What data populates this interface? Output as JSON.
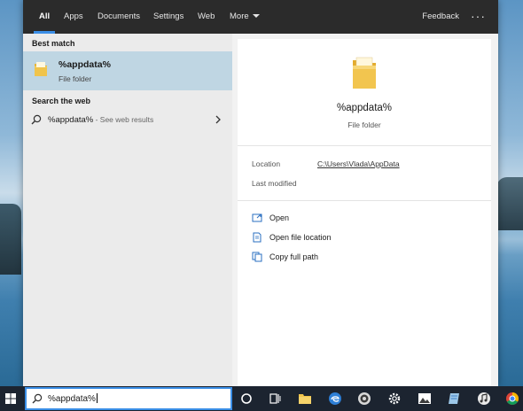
{
  "tabs": [
    {
      "label": "All",
      "active": true
    },
    {
      "label": "Apps"
    },
    {
      "label": "Documents"
    },
    {
      "label": "Settings"
    },
    {
      "label": "Web"
    },
    {
      "label": "More"
    }
  ],
  "header": {
    "feedback": "Feedback",
    "more_options": "···"
  },
  "results": {
    "best_match_label": "Best match",
    "best_match": {
      "title": "%appdata%",
      "subtitle": "File folder",
      "icon": "folder-icon"
    },
    "search_web_label": "Search the web",
    "web_result": {
      "query": "%appdata%",
      "hint": " - See web results",
      "icon": "search-icon"
    }
  },
  "preview": {
    "title": "%appdata%",
    "subtitle": "File folder",
    "location_label": "Location",
    "location_value": "C:\\Users\\Vlada\\AppData",
    "modified_label": "Last modified",
    "actions": [
      {
        "label": "Open",
        "icon": "open-icon"
      },
      {
        "label": "Open file location",
        "icon": "file-location-icon"
      },
      {
        "label": "Copy full path",
        "icon": "copy-icon"
      }
    ]
  },
  "searchbox": {
    "value": "%appdata%"
  },
  "taskbar_icons": [
    "windows-start-icon",
    "search-icon",
    "cortana-icon",
    "task-view-icon",
    "file-explorer-icon",
    "edge-icon",
    "store-icon",
    "settings-gear-icon",
    "photos-icon",
    "notepad-icon",
    "media-icon",
    "chrome-icon"
  ],
  "colors": {
    "accent": "#3a8ee6",
    "selection": "#bfd6e3",
    "topbar": "#2b2b2b",
    "taskbar": "#1c2430",
    "folder": "#f0c44c"
  }
}
